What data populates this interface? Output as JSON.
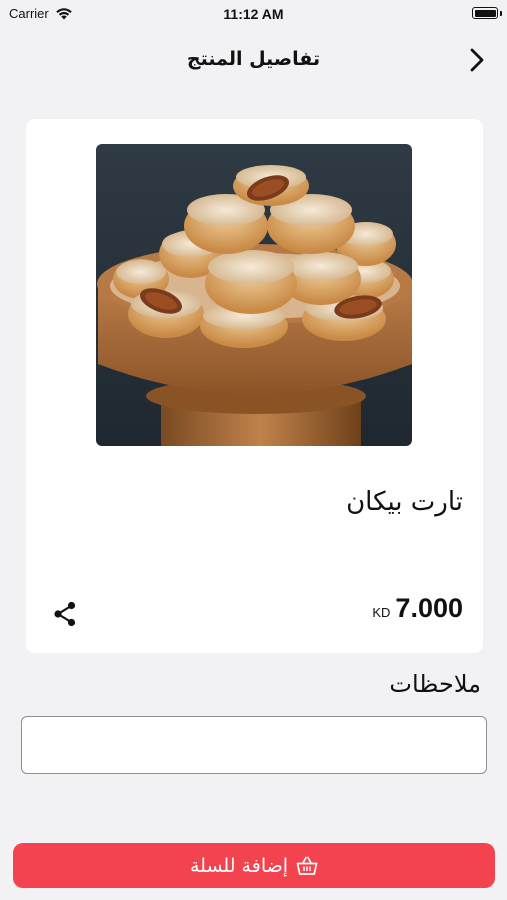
{
  "status_bar": {
    "carrier": "Carrier",
    "time": "11:12 AM"
  },
  "nav": {
    "title": "تفاصيل المنتج",
    "back_icon": "chevron-right-icon"
  },
  "product": {
    "name": "تارت بيكان",
    "price": "7.000",
    "currency": "KD",
    "image_icon": "pecan-tart-photo"
  },
  "notes": {
    "label": "ملاحظات",
    "value": "",
    "placeholder": ""
  },
  "cart": {
    "add_label": "إضافة للسلة",
    "icon": "basket-icon"
  },
  "colors": {
    "accent": "#f2434f",
    "background": "#f2f2f5",
    "card": "#ffffff"
  }
}
